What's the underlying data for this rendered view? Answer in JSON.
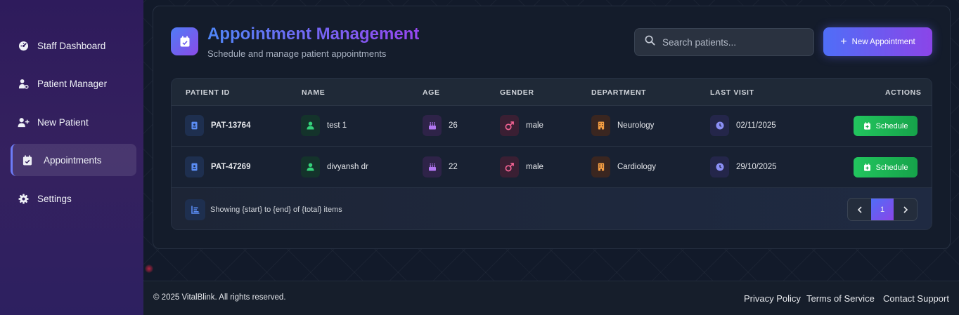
{
  "sidebar": {
    "items": [
      {
        "label": "Staff Dashboard",
        "icon": "dashboard-gauge-icon"
      },
      {
        "label": "Patient Manager",
        "icon": "user-gear-icon"
      },
      {
        "label": "New Patient",
        "icon": "user-plus-icon"
      },
      {
        "label": "Appointments",
        "icon": "calendar-check-icon",
        "active": true
      },
      {
        "label": "Settings",
        "icon": "gear-icon"
      }
    ]
  },
  "header": {
    "title": "Appointment Management",
    "subtitle": "Schedule and manage patient appointments",
    "search_placeholder": "Search patients...",
    "new_button_label": "New Appointment"
  },
  "table": {
    "columns": [
      "PATIENT ID",
      "NAME",
      "AGE",
      "GENDER",
      "DEPARTMENT",
      "LAST VISIT",
      "ACTIONS"
    ],
    "rows": [
      {
        "patient_id": "PAT-13764",
        "name": "test 1",
        "age": "26",
        "gender": "male",
        "department": "Neurology",
        "last_visit": "02/11/2025",
        "action": "Schedule"
      },
      {
        "patient_id": "PAT-47269",
        "name": "divyansh dr",
        "age": "22",
        "gender": "male",
        "department": "Cardiology",
        "last_visit": "29/10/2025",
        "action": "Schedule"
      }
    ],
    "footer_text": "Showing {start} to {end} of {total} items",
    "pagination": {
      "current_page": "1"
    }
  },
  "footer": {
    "copyright": "© 2025 VitalBlink. All rights reserved.",
    "links": [
      "Privacy Policy",
      "Terms of Service",
      "Contact Support"
    ]
  },
  "colors": {
    "accent_blue": "#4f6ef7",
    "accent_purple": "#8b45e8",
    "success_green": "#22c55e",
    "sidebar_bg": "#2e1b5c"
  }
}
